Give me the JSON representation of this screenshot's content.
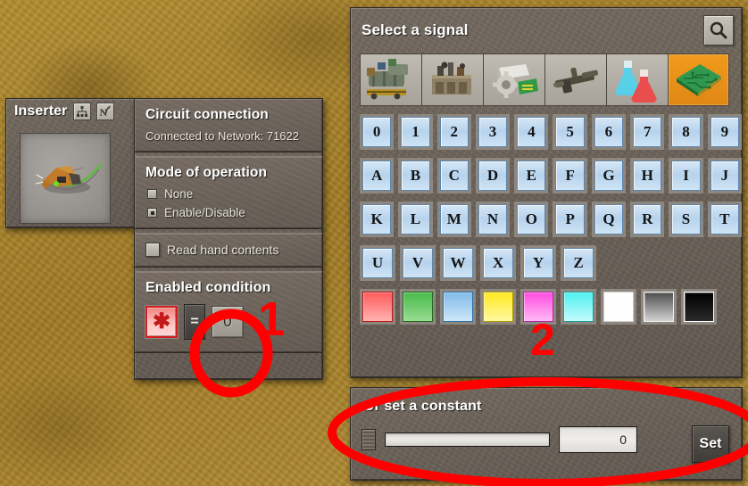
{
  "game": "Factorio",
  "scene": {
    "background": "desert-ground",
    "background_color": "#a8822c"
  },
  "entity_panel": {
    "title": "Inserter",
    "icons": [
      {
        "name": "circuit-network-icon",
        "glyph": "network-tree"
      },
      {
        "name": "wireless-network-icon",
        "glyph": "N-signal"
      }
    ],
    "preview_alt": "inserter-entity-preview"
  },
  "settings_panel": {
    "circuit_connection": {
      "title": "Circuit connection",
      "status": "Connected to Network: 71622"
    },
    "mode_of_operation": {
      "title": "Mode of operation",
      "options": [
        {
          "label": "None",
          "selected": false
        },
        {
          "label": "Enable/Disable",
          "selected": true
        }
      ]
    },
    "read_hand_contents": {
      "label": "Read hand contents",
      "checked": false
    },
    "enabled_condition": {
      "title": "Enabled condition",
      "signal_slot": {
        "name": "wildcard-signal",
        "glyph": "✱",
        "color": "#c41919"
      },
      "operator": "=",
      "constant_slot": "0"
    }
  },
  "signal_panel": {
    "title": "Select a signal",
    "search_icon": "search-icon",
    "group_tabs": [
      {
        "name": "tab-logistics",
        "selected": false
      },
      {
        "name": "tab-production",
        "selected": false
      },
      {
        "name": "tab-intermediate-products",
        "selected": false
      },
      {
        "name": "tab-combat",
        "selected": false
      },
      {
        "name": "tab-fluids-science",
        "selected": false
      },
      {
        "name": "tab-circuit-signals",
        "selected": true
      }
    ],
    "rows": [
      {
        "name": "digits-row",
        "keys": [
          "0",
          "1",
          "2",
          "3",
          "4",
          "5",
          "6",
          "7",
          "8",
          "9"
        ]
      },
      {
        "name": "letters-row-1",
        "keys": [
          "A",
          "B",
          "C",
          "D",
          "E",
          "F",
          "G",
          "H",
          "I",
          "J"
        ]
      },
      {
        "name": "letters-row-2",
        "keys": [
          "K",
          "L",
          "M",
          "N",
          "O",
          "P",
          "Q",
          "R",
          "S",
          "T"
        ]
      },
      {
        "name": "letters-row-3",
        "keys": [
          "U",
          "V",
          "W",
          "X",
          "Y",
          "Z"
        ]
      }
    ],
    "colors": [
      {
        "name": "signal-red",
        "hex": "#ff6a6a",
        "border": "#c01717"
      },
      {
        "name": "signal-green",
        "hex": "#6ec96e",
        "border": "#1f6b1f"
      },
      {
        "name": "signal-blue",
        "hex": "#9ecbf0",
        "border": "#2f6fa8"
      },
      {
        "name": "signal-yellow",
        "hex": "#ffef4d",
        "border": "#b09a00"
      },
      {
        "name": "signal-pink",
        "hex": "#ff7ce8",
        "border": "#b32a9d"
      },
      {
        "name": "signal-cyan",
        "hex": "#6ef2f2",
        "border": "#1f9c9c"
      },
      {
        "name": "signal-white",
        "hex": "#ffffff",
        "border": "#c8c4be"
      },
      {
        "name": "signal-grey",
        "hex": "#8d8d8d",
        "border": "#5a5a5a"
      },
      {
        "name": "signal-black",
        "hex": "#111111",
        "border": "#ffffff"
      }
    ]
  },
  "constant_panel": {
    "title": "Or set a constant",
    "slider_value": 0,
    "number_value": "0",
    "set_button": "Set"
  },
  "annotations": [
    {
      "name": "annotation-1",
      "label": "1",
      "color": "#ff0000",
      "shape": "circle-around-constant-slot"
    },
    {
      "name": "annotation-2",
      "label": "2",
      "color": "#ff0000",
      "shape": "ellipse-around-constant-panel"
    }
  ]
}
